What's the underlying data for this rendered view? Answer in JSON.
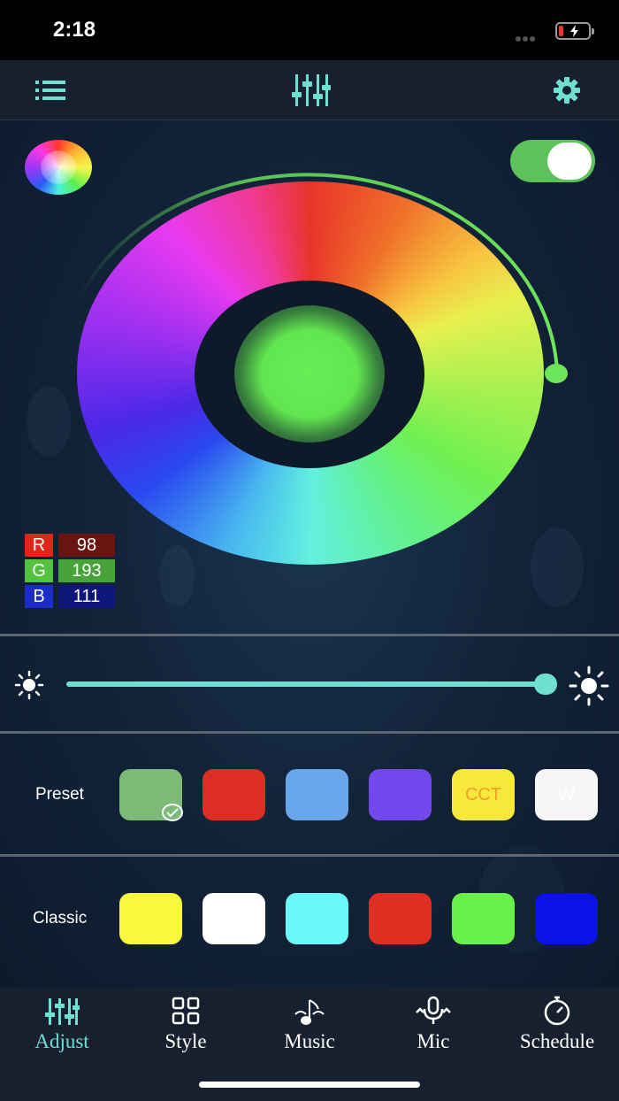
{
  "status_bar": {
    "time": "2:18"
  },
  "colors": {
    "accent": "#6ee0cf",
    "toggle_on": "#5ec25a",
    "arc": "#6de65a",
    "selected_color": "#62c16f"
  },
  "rgb": {
    "r": {
      "label": "R",
      "value": "98",
      "label_bg": "#e0251a",
      "value_bg": "#6a1410"
    },
    "g": {
      "label": "G",
      "value": "193",
      "label_bg": "#52c23f",
      "value_bg": "#48a43a"
    },
    "b": {
      "label": "B",
      "value": "111",
      "label_bg": "#1b2cc8",
      "value_bg": "#0e167a"
    }
  },
  "power_toggle": {
    "on": true
  },
  "brightness": {
    "level_fraction": 0.99
  },
  "preset": {
    "label": "Preset",
    "swatches": [
      {
        "color": "#7cba78",
        "text": "",
        "selected": true
      },
      {
        "color": "#dc2e22",
        "text": ""
      },
      {
        "color": "#6aa6ea",
        "text": ""
      },
      {
        "color": "#7248ec",
        "text": ""
      },
      {
        "color": "#f8e83a",
        "text": "CCT",
        "text_color": "#f0a030"
      },
      {
        "color": "#f6f6f6",
        "text": "W",
        "text_color": "#ffffff"
      }
    ]
  },
  "classic": {
    "label": "Classic",
    "swatches": [
      {
        "color": "#f8f83c"
      },
      {
        "color": "#ffffff"
      },
      {
        "color": "#6cf8f8"
      },
      {
        "color": "#e02e22"
      },
      {
        "color": "#6af04a"
      },
      {
        "color": "#0b12e8"
      }
    ]
  },
  "tabs": [
    {
      "label": "Adjust",
      "icon": "sliders-icon",
      "active": true
    },
    {
      "label": "Style",
      "icon": "grid-icon"
    },
    {
      "label": "Music",
      "icon": "music-note-icon"
    },
    {
      "label": "Mic",
      "icon": "microphone-icon"
    },
    {
      "label": "Schedule",
      "icon": "stopwatch-icon"
    }
  ]
}
